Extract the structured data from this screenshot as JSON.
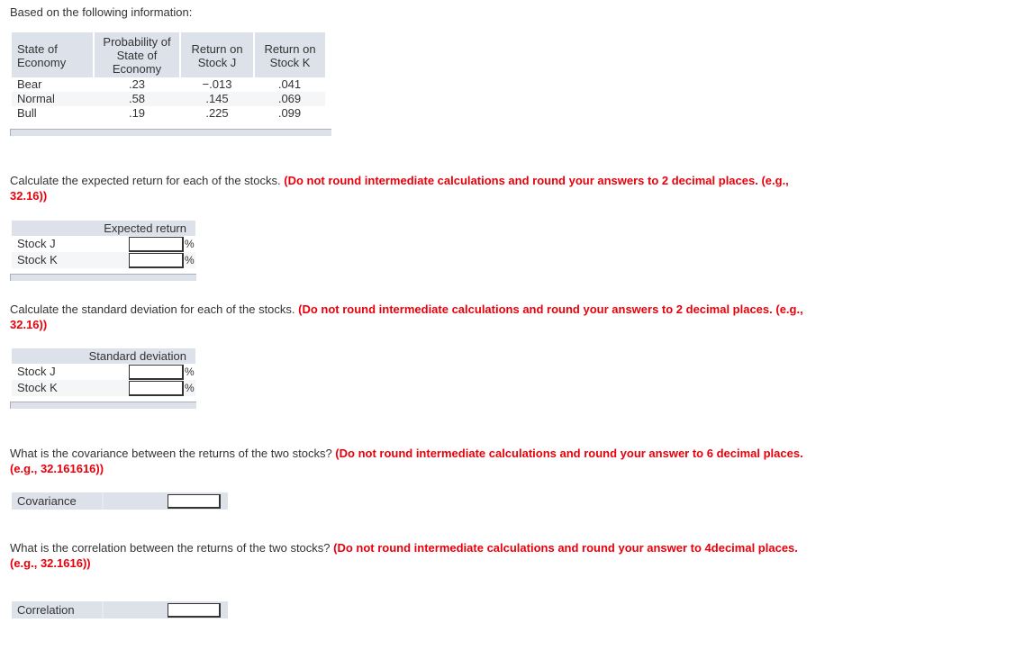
{
  "intro": "Based on the following information:",
  "info_table": {
    "headers": [
      "State of\nEconomy",
      "Probability of\nState of\nEconomy",
      "Return on\nStock J",
      "Return on\nStock K"
    ],
    "header_lines": [
      [
        "State of",
        "Economy"
      ],
      [
        "Probability of",
        "State of",
        "Economy"
      ],
      [
        "Return on",
        "Stock J"
      ],
      [
        "Return on",
        "Stock K"
      ]
    ],
    "rows": [
      {
        "state": "Bear",
        "probability": ".23",
        "return_j": "−.013",
        "return_k": ".041"
      },
      {
        "state": "Normal",
        "probability": ".58",
        "return_j": ".145",
        "return_k": ".069"
      },
      {
        "state": "Bull",
        "probability": ".19",
        "return_j": ".225",
        "return_k": ".099"
      }
    ]
  },
  "q1": {
    "text": "Calculate the expected return for each of the stocks. ",
    "warning": "(Do not round intermediate calculations and round your answers to 2 decimal places. (e.g., 32.16))",
    "column_header": "Expected return",
    "rows": [
      {
        "label": "Stock J",
        "value": "",
        "unit": "%"
      },
      {
        "label": "Stock K",
        "value": "",
        "unit": "%"
      }
    ]
  },
  "q2": {
    "text": "Calculate the standard deviation for each of the stocks. ",
    "warning": "(Do not round intermediate calculations and round your answers to 2 decimal places. (e.g., 32.16))",
    "column_header": "Standard deviation",
    "rows": [
      {
        "label": "Stock J",
        "value": "",
        "unit": "%"
      },
      {
        "label": "Stock K",
        "value": "",
        "unit": "%"
      }
    ]
  },
  "q3": {
    "text": "What is the covariance between the returns of the two stocks? ",
    "warning": "(Do not round intermediate calculations and round your answer to 6 decimal places. (e.g., 32.161616))",
    "label": "Covariance",
    "value": ""
  },
  "q4": {
    "text": "What is the correlation between the returns of the two stocks? ",
    "warning": "(Do not round intermediate calculations and round your answer to 4decimal places. (e.g., 32.1616))",
    "label": "Correlation",
    "value": ""
  },
  "colors": {
    "warning": "#e8000b",
    "header_bg": "#dde1ea",
    "alt_row_bg": "#f5f6f8",
    "text": "#333333"
  }
}
